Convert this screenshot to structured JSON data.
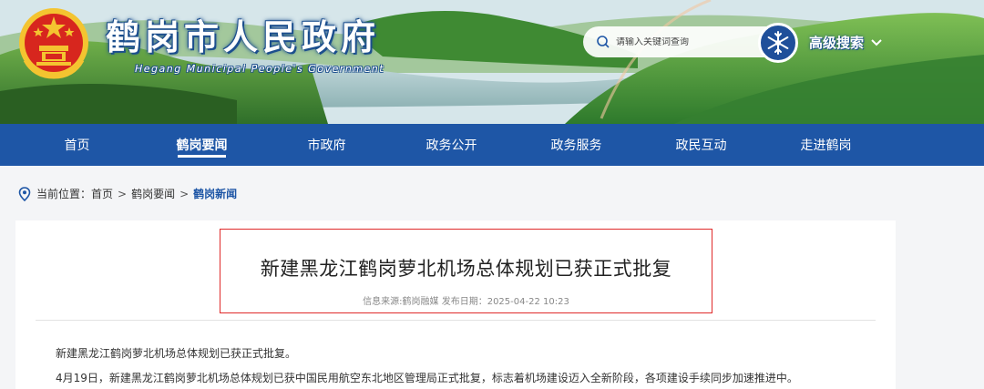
{
  "header": {
    "site_title": "鹤岗市人民政府",
    "site_subtitle": "Hegang Municipal People's Government",
    "search_placeholder": "请输入关键词查询",
    "advanced_search_label": "高级搜索",
    "brand_color": "#1e56a6"
  },
  "nav": {
    "items": [
      {
        "label": "首页"
      },
      {
        "label": "鹤岗要闻",
        "active": true
      },
      {
        "label": "市政府"
      },
      {
        "label": "政务公开"
      },
      {
        "label": "政务服务"
      },
      {
        "label": "政民互动"
      },
      {
        "label": "走进鹤岗"
      }
    ]
  },
  "breadcrumb": {
    "prefix": "当前位置：",
    "items": [
      "首页",
      "鹤岗要闻",
      "鹤岗新闻"
    ],
    "separator": ">"
  },
  "article": {
    "title": "新建黑龙江鹤岗萝北机场总体规划已获正式批复",
    "meta": "信息来源:鹤岗融媒 发布日期：2025-04-22 10:23",
    "paragraphs": [
      "新建黑龙江鹤岗萝北机场总体规划已获正式批复。",
      "4月19日，新建黑龙江鹤岗萝北机场总体规划已获中国民用航空东北地区管理局正式批复，标志着机场建设迈入全新阶段，各项建设手续同步加速推进中。"
    ]
  }
}
